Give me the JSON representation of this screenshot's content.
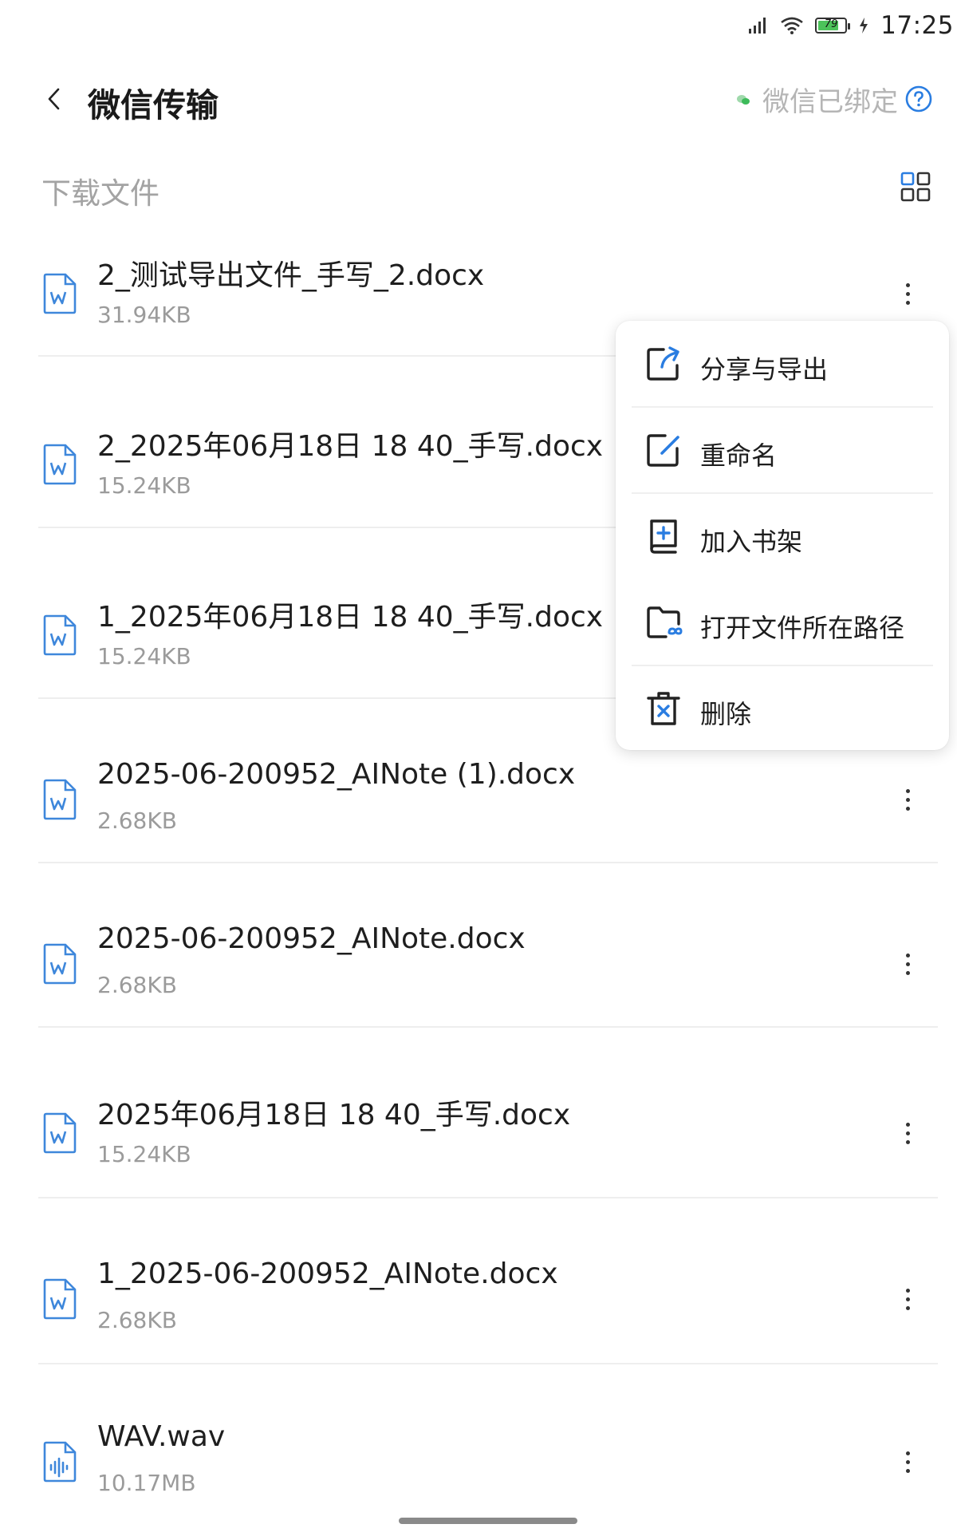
{
  "status_bar": {
    "time": "17:25",
    "battery_level": "79",
    "battery_fill": 0.79
  },
  "header": {
    "title": "微信传输",
    "bound_text": "微信已绑定"
  },
  "section": {
    "title": "下载文件"
  },
  "files": [
    {
      "name": "2_测试导出文件_手写_2.docx",
      "size": "31.94KB",
      "type": "word-icon"
    },
    {
      "name": "2_2025年06月18日 18 40_手写.docx",
      "size": "15.24KB",
      "type": "word-icon"
    },
    {
      "name": "1_2025年06月18日 18 40_手写.docx",
      "size": "15.24KB",
      "type": "word-icon"
    },
    {
      "name": "2025-06-200952_AINote (1).docx",
      "size": "2.68KB",
      "type": "word-icon"
    },
    {
      "name": "2025-06-200952_AINote.docx",
      "size": "2.68KB",
      "type": "word-icon"
    },
    {
      "name": "2025年06月18日 18 40_手写.docx",
      "size": "15.24KB",
      "type": "word-icon"
    },
    {
      "name": "1_2025-06-200952_AINote.docx",
      "size": "2.68KB",
      "type": "word-icon"
    },
    {
      "name": "WAV.wav",
      "size": "10.17MB",
      "type": "audio-icon"
    }
  ],
  "context_menu": {
    "items": [
      {
        "label": "分享与导出",
        "icon": "share-export-icon"
      },
      {
        "label": "重命名",
        "icon": "rename-icon"
      },
      {
        "label": "加入书架",
        "icon": "add-to-bookshelf-icon"
      },
      {
        "label": "打开文件所在路径",
        "icon": "open-folder-icon"
      },
      {
        "label": "删除",
        "icon": "delete-icon"
      }
    ]
  },
  "colors": {
    "accent": "#2a7de1",
    "word_icon": "#3e87db",
    "wechat_green": "#3dbb5a"
  }
}
